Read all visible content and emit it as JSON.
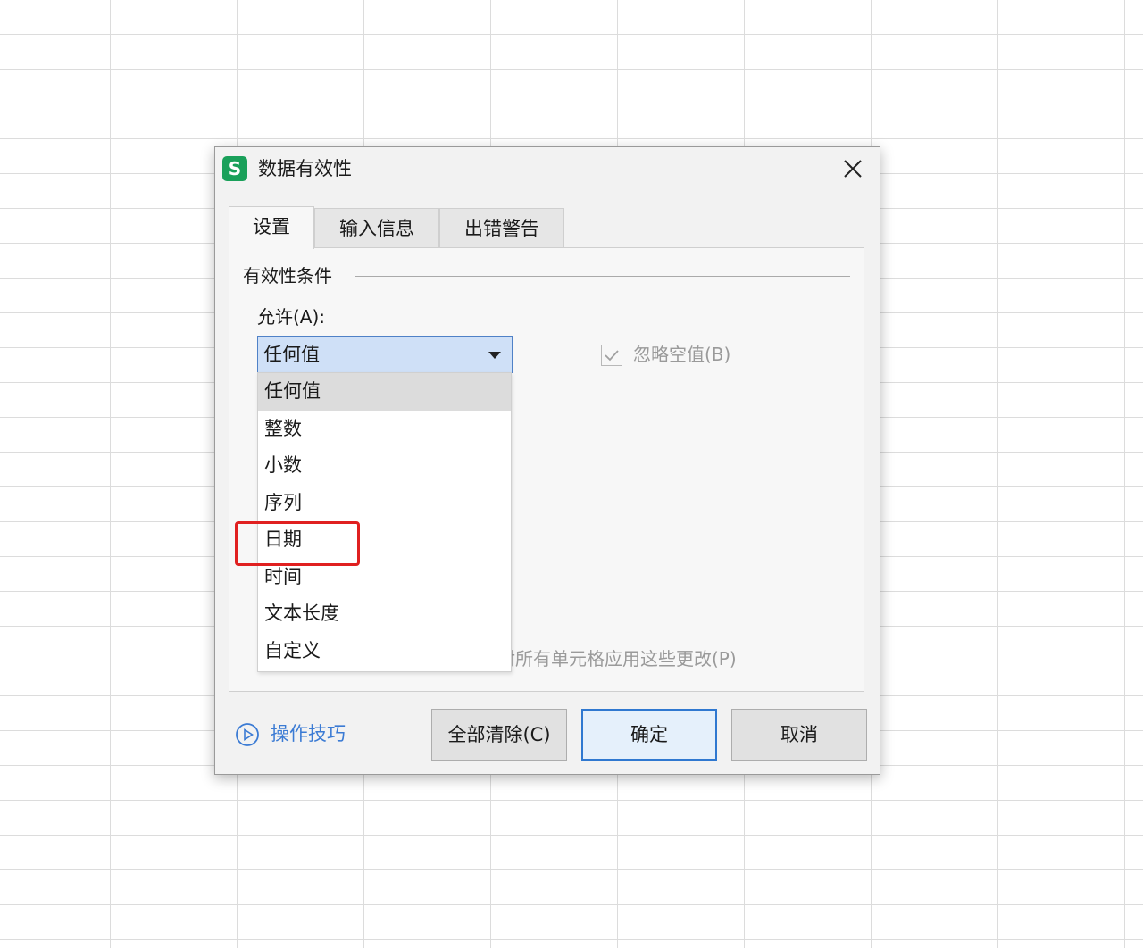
{
  "dialog": {
    "app_logo": "S",
    "title": "数据有效性",
    "close_icon": "close-icon"
  },
  "tabs": [
    {
      "label": "设置",
      "active": true
    },
    {
      "label": "输入信息",
      "active": false
    },
    {
      "label": "出错警告",
      "active": false
    }
  ],
  "settings": {
    "group_label": "有效性条件",
    "allow_label": "允许(A):",
    "allow_value": "任何值",
    "ignore_blank_label": "忽略空值(B)",
    "ignore_blank_checked": true,
    "apply_all_label": "对所有单元格应用这些更改(P)"
  },
  "dropdown": {
    "items": [
      "任何值",
      "整数",
      "小数",
      "序列",
      "日期",
      "时间",
      "文本长度",
      "自定义"
    ],
    "selected_index": 0,
    "highlighted_item": "日期",
    "highlight_color": "#e02020"
  },
  "footer": {
    "tips_label": "操作技巧",
    "tips_icon": "play-circle-icon",
    "clear_all_label": "全部清除(C)",
    "ok_label": "确定",
    "cancel_label": "取消"
  },
  "colors": {
    "accent": "#2f78d0",
    "logo": "#1aa05a",
    "link": "#3b7bd4"
  }
}
